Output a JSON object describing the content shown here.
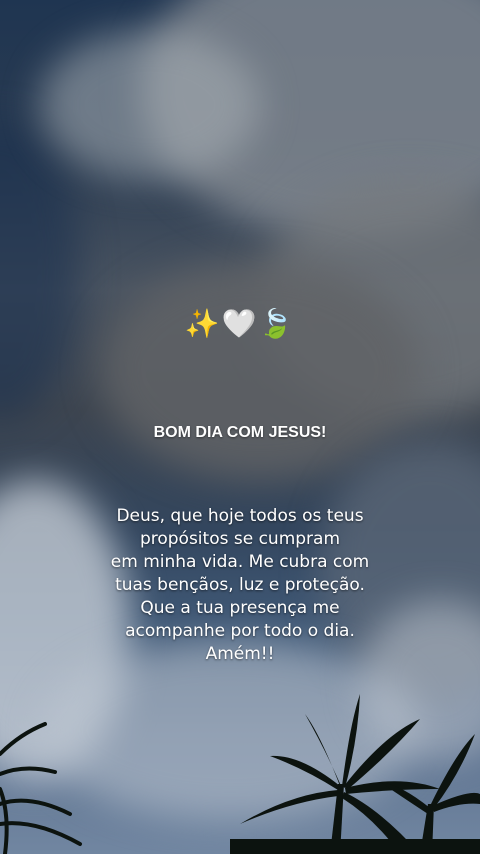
{
  "emoji": "✨🤍🍃",
  "title": "BOM DIA COM JESUS!",
  "message_lines": [
    "Deus, que hoje todos os teus",
    "propósitos se cumpram",
    "em minha vida. Me cubra com",
    "tuas bençãos, luz e proteção.",
    "Que a tua presença me",
    "acompanhe por todo o dia.",
    "Amém!!"
  ],
  "colors": {
    "sky_top": "#1f3551",
    "storm_cloud": "#3d4550",
    "text": "#ffffff",
    "palm_silhouette": "#0c130f"
  }
}
